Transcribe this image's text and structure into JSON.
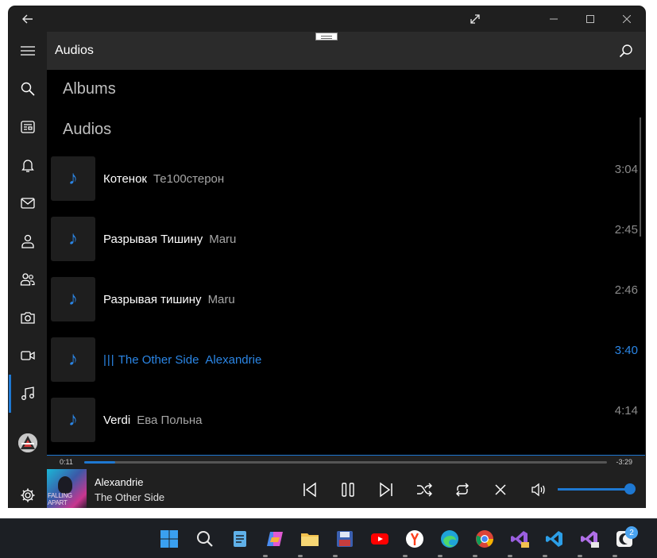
{
  "window": {
    "back_icon": "back-arrow-icon",
    "expand_icon": "expand-icon",
    "min_icon": "minimize-icon",
    "max_icon": "maximize-icon",
    "close_icon": "close-icon"
  },
  "nav": {
    "items": [
      {
        "icon": "hamburger-icon"
      },
      {
        "icon": "search-icon"
      },
      {
        "icon": "news-icon"
      },
      {
        "icon": "bell-icon"
      },
      {
        "icon": "mail-icon"
      },
      {
        "icon": "person-icon"
      },
      {
        "icon": "people-icon"
      },
      {
        "icon": "camera-icon"
      },
      {
        "icon": "video-icon"
      },
      {
        "icon": "music-icon"
      }
    ],
    "active": "music-icon",
    "settings_icon": "gear-icon"
  },
  "header": {
    "title": "Audios",
    "search_icon": "search-icon"
  },
  "sections": {
    "albums": "Albums",
    "audios": "Audios"
  },
  "tracks": [
    {
      "title": "Котенок",
      "artist": "Те100стерон",
      "duration": "3:04",
      "active": false
    },
    {
      "title": "Разрывая Тишину",
      "artist": "Maru",
      "duration": "2:45",
      "active": false
    },
    {
      "title": "Разрывая тишину",
      "artist": "Maru",
      "duration": "2:46",
      "active": false
    },
    {
      "title": "The Other Side",
      "artist": "Alexandrie",
      "duration": "3:40",
      "active": true
    },
    {
      "title": "Verdi",
      "artist": "Ева Польна",
      "duration": "4:14",
      "active": false
    }
  ],
  "player": {
    "elapsed": "0:11",
    "remaining": "-3:29",
    "progress": 0.06,
    "artist": "Alexandrie",
    "title": "The Other Side",
    "volume": 0.92,
    "cover_text": "FALLING APART"
  },
  "colors": {
    "accent": "#1e78d2",
    "playing": "#2b86e6"
  },
  "taskbar": {
    "apps": [
      "windows-start-icon",
      "search-icon",
      "notepad-icon",
      "copilot-icon",
      "file-explorer-icon",
      "save-app-icon",
      "youtube-icon",
      "yandex-browser-icon",
      "edge-icon",
      "chrome-icon",
      "visual-studio-preview-icon",
      "vscode-icon",
      "visual-studio-insiders-icon",
      "app-icon"
    ],
    "badge": "2"
  }
}
